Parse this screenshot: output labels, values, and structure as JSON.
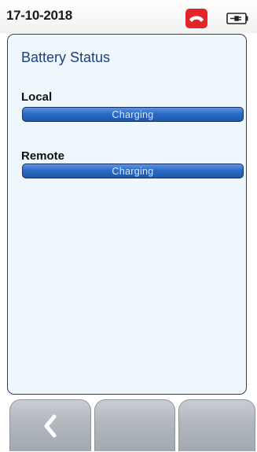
{
  "status_bar": {
    "date": "17-10-2018",
    "call_icon": "phone-hangup-icon",
    "call_icon_color": "#e2252b",
    "power_icon": "battery-plug-icon"
  },
  "panel": {
    "title": "Battery Status",
    "sections": [
      {
        "label": "Local",
        "status": "Charging"
      },
      {
        "label": "Remote",
        "status": "Charging"
      }
    ]
  },
  "softkeys": [
    {
      "icon": "back-chevron-icon",
      "label": ""
    },
    {
      "icon": "",
      "label": ""
    },
    {
      "icon": "",
      "label": ""
    }
  ],
  "colors": {
    "accent": "#1d3f7f",
    "bar": "#2c6cc6",
    "panel_bg": "#eef7fb"
  }
}
